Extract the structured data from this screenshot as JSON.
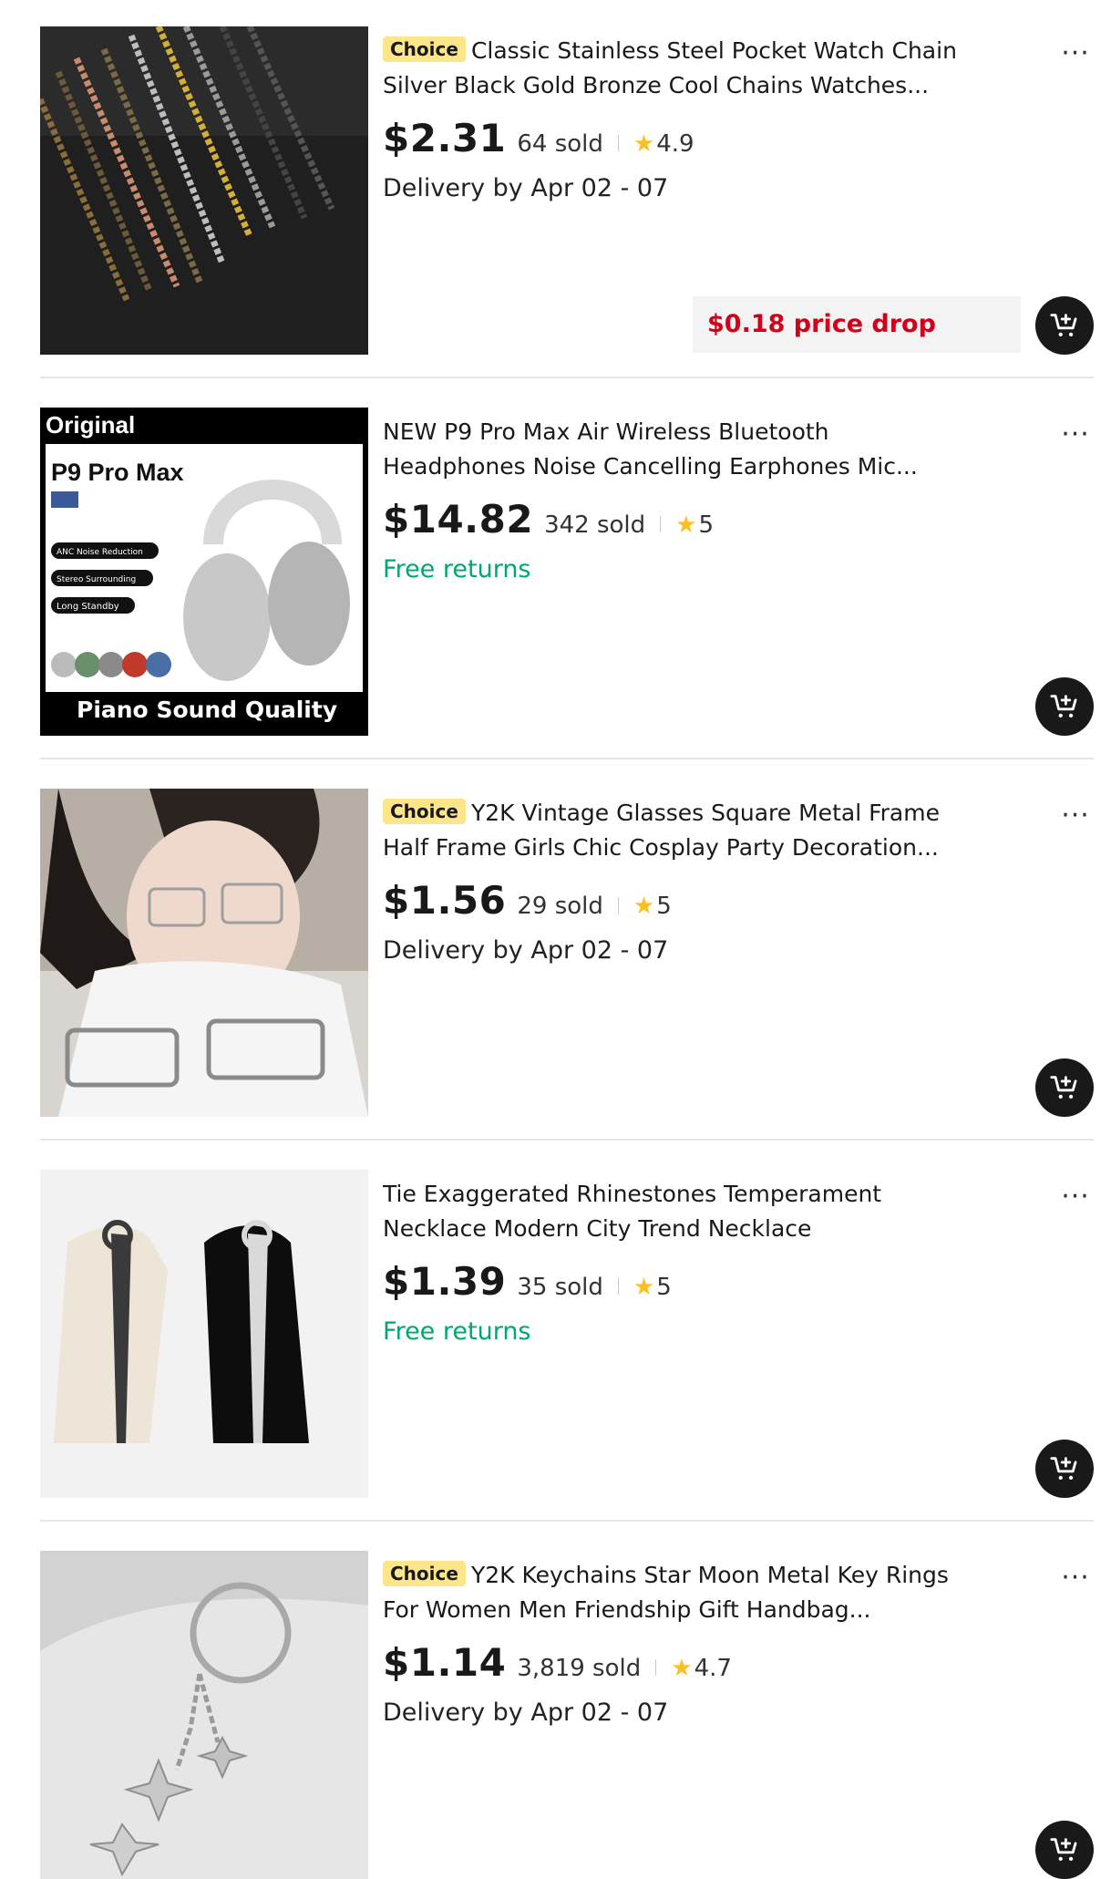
{
  "colors": {
    "choice_badge_bg": "#fde68a",
    "price_drop_text": "#d0021b",
    "free_returns_text": "#00a86b",
    "star": "#fbbf24",
    "cart_button_bg": "#191919"
  },
  "products": [
    {
      "badge": "Choice",
      "title": "Classic Stainless Steel Pocket Watch Chain Silver Black Gold Bronze Cool Chains Watches...",
      "price": "$2.31",
      "sold": "64 sold",
      "rating": "4.9",
      "extra": "Delivery by Apr 02 - 07",
      "price_drop": "$0.18 price drop",
      "image": "watch-chains-photo"
    },
    {
      "badge": "",
      "title": "NEW P9 Pro Max Air Wireless Bluetooth Headphones Noise Cancelling Earphones Mic...",
      "price": "$14.82",
      "sold": "342 sold",
      "rating": "5",
      "extra": "Free returns",
      "image": "headphones-photo",
      "image_text": {
        "tag": "Original",
        "model": "P9 Pro Max",
        "feature1": "ANC Noise Reduction",
        "feature2": "Stereo Surrounding",
        "feature3": "Long Standby",
        "caption": "Piano Sound Quality"
      }
    },
    {
      "badge": "Choice",
      "title": "Y2K Vintage Glasses Square Metal Frame Half Frame Girls Chic Cosplay Party Decoration...",
      "price": "$1.56",
      "sold": "29 sold",
      "rating": "5",
      "extra": "Delivery by Apr 02 - 07",
      "image": "glasses-photo"
    },
    {
      "badge": "",
      "title": "Tie Exaggerated Rhinestones Temperament Necklace Modern City Trend Necklace",
      "price": "$1.39",
      "sold": "35 sold",
      "rating": "5",
      "extra": "Free returns",
      "image": "rhinestone-tie-photo"
    },
    {
      "badge": "Choice",
      "title": "Y2K Keychains Star Moon Metal Key Rings For Women Men Friendship Gift Handbag...",
      "price": "$1.14",
      "sold": "3,819 sold",
      "rating": "4.7",
      "extra": "Delivery by Apr 02 - 07",
      "image": "star-keychain-photo"
    }
  ]
}
